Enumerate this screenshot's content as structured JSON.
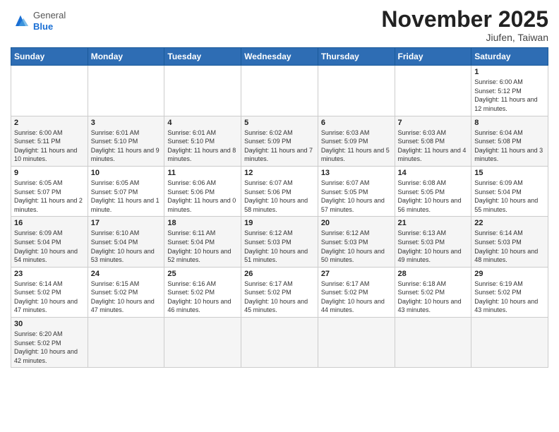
{
  "header": {
    "logo": {
      "general": "General",
      "blue": "Blue"
    },
    "title": "November 2025",
    "location": "Jiufen, Taiwan"
  },
  "weekdays": [
    "Sunday",
    "Monday",
    "Tuesday",
    "Wednesday",
    "Thursday",
    "Friday",
    "Saturday"
  ],
  "weeks": [
    [
      {
        "day": "",
        "info": ""
      },
      {
        "day": "",
        "info": ""
      },
      {
        "day": "",
        "info": ""
      },
      {
        "day": "",
        "info": ""
      },
      {
        "day": "",
        "info": ""
      },
      {
        "day": "",
        "info": ""
      },
      {
        "day": "1",
        "info": "Sunrise: 6:00 AM\nSunset: 5:12 PM\nDaylight: 11 hours and 12 minutes."
      }
    ],
    [
      {
        "day": "2",
        "info": "Sunrise: 6:00 AM\nSunset: 5:11 PM\nDaylight: 11 hours and 10 minutes."
      },
      {
        "day": "3",
        "info": "Sunrise: 6:01 AM\nSunset: 5:10 PM\nDaylight: 11 hours and 9 minutes."
      },
      {
        "day": "4",
        "info": "Sunrise: 6:01 AM\nSunset: 5:10 PM\nDaylight: 11 hours and 8 minutes."
      },
      {
        "day": "5",
        "info": "Sunrise: 6:02 AM\nSunset: 5:09 PM\nDaylight: 11 hours and 7 minutes."
      },
      {
        "day": "6",
        "info": "Sunrise: 6:03 AM\nSunset: 5:09 PM\nDaylight: 11 hours and 5 minutes."
      },
      {
        "day": "7",
        "info": "Sunrise: 6:03 AM\nSunset: 5:08 PM\nDaylight: 11 hours and 4 minutes."
      },
      {
        "day": "8",
        "info": "Sunrise: 6:04 AM\nSunset: 5:08 PM\nDaylight: 11 hours and 3 minutes."
      }
    ],
    [
      {
        "day": "9",
        "info": "Sunrise: 6:05 AM\nSunset: 5:07 PM\nDaylight: 11 hours and 2 minutes."
      },
      {
        "day": "10",
        "info": "Sunrise: 6:05 AM\nSunset: 5:07 PM\nDaylight: 11 hours and 1 minute."
      },
      {
        "day": "11",
        "info": "Sunrise: 6:06 AM\nSunset: 5:06 PM\nDaylight: 11 hours and 0 minutes."
      },
      {
        "day": "12",
        "info": "Sunrise: 6:07 AM\nSunset: 5:06 PM\nDaylight: 10 hours and 58 minutes."
      },
      {
        "day": "13",
        "info": "Sunrise: 6:07 AM\nSunset: 5:05 PM\nDaylight: 10 hours and 57 minutes."
      },
      {
        "day": "14",
        "info": "Sunrise: 6:08 AM\nSunset: 5:05 PM\nDaylight: 10 hours and 56 minutes."
      },
      {
        "day": "15",
        "info": "Sunrise: 6:09 AM\nSunset: 5:04 PM\nDaylight: 10 hours and 55 minutes."
      }
    ],
    [
      {
        "day": "16",
        "info": "Sunrise: 6:09 AM\nSunset: 5:04 PM\nDaylight: 10 hours and 54 minutes."
      },
      {
        "day": "17",
        "info": "Sunrise: 6:10 AM\nSunset: 5:04 PM\nDaylight: 10 hours and 53 minutes."
      },
      {
        "day": "18",
        "info": "Sunrise: 6:11 AM\nSunset: 5:04 PM\nDaylight: 10 hours and 52 minutes."
      },
      {
        "day": "19",
        "info": "Sunrise: 6:12 AM\nSunset: 5:03 PM\nDaylight: 10 hours and 51 minutes."
      },
      {
        "day": "20",
        "info": "Sunrise: 6:12 AM\nSunset: 5:03 PM\nDaylight: 10 hours and 50 minutes."
      },
      {
        "day": "21",
        "info": "Sunrise: 6:13 AM\nSunset: 5:03 PM\nDaylight: 10 hours and 49 minutes."
      },
      {
        "day": "22",
        "info": "Sunrise: 6:14 AM\nSunset: 5:03 PM\nDaylight: 10 hours and 48 minutes."
      }
    ],
    [
      {
        "day": "23",
        "info": "Sunrise: 6:14 AM\nSunset: 5:02 PM\nDaylight: 10 hours and 47 minutes."
      },
      {
        "day": "24",
        "info": "Sunrise: 6:15 AM\nSunset: 5:02 PM\nDaylight: 10 hours and 47 minutes."
      },
      {
        "day": "25",
        "info": "Sunrise: 6:16 AM\nSunset: 5:02 PM\nDaylight: 10 hours and 46 minutes."
      },
      {
        "day": "26",
        "info": "Sunrise: 6:17 AM\nSunset: 5:02 PM\nDaylight: 10 hours and 45 minutes."
      },
      {
        "day": "27",
        "info": "Sunrise: 6:17 AM\nSunset: 5:02 PM\nDaylight: 10 hours and 44 minutes."
      },
      {
        "day": "28",
        "info": "Sunrise: 6:18 AM\nSunset: 5:02 PM\nDaylight: 10 hours and 43 minutes."
      },
      {
        "day": "29",
        "info": "Sunrise: 6:19 AM\nSunset: 5:02 PM\nDaylight: 10 hours and 43 minutes."
      }
    ],
    [
      {
        "day": "30",
        "info": "Sunrise: 6:20 AM\nSunset: 5:02 PM\nDaylight: 10 hours and 42 minutes."
      },
      {
        "day": "",
        "info": ""
      },
      {
        "day": "",
        "info": ""
      },
      {
        "day": "",
        "info": ""
      },
      {
        "day": "",
        "info": ""
      },
      {
        "day": "",
        "info": ""
      },
      {
        "day": "",
        "info": ""
      }
    ]
  ]
}
